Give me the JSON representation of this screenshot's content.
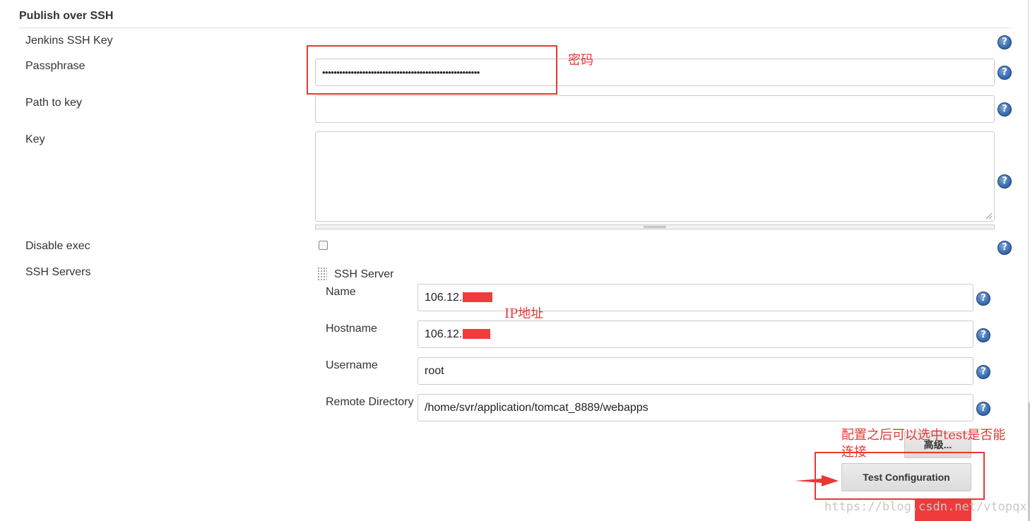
{
  "section": {
    "title": "Publish over SSH"
  },
  "fields": {
    "jenkins_ssh_key": {
      "label": "Jenkins SSH Key"
    },
    "passphrase": {
      "label": "Passphrase",
      "value": "•••••••••••••••••••••••••••••••••••••••••••••••••••••••"
    },
    "path_to_key": {
      "label": "Path to key",
      "value": ""
    },
    "key": {
      "label": "Key",
      "value": ""
    },
    "disable_exec": {
      "label": "Disable exec",
      "checked": false
    },
    "ssh_servers": {
      "label": "SSH Servers"
    }
  },
  "ssh_server": {
    "header": "SSH Server",
    "name": {
      "label": "Name",
      "value": "106.12."
    },
    "hostname": {
      "label": "Hostname",
      "value": "106.12."
    },
    "username": {
      "label": "Username",
      "value": "root"
    },
    "remote_directory": {
      "label": "Remote Directory",
      "value": "/home/svr/application/tomcat_8889/webapps"
    },
    "advanced_button": "高级...",
    "test_button": "Test Configuration"
  },
  "help_icon": "?",
  "annotations": {
    "password": "密码",
    "ip_address": "IP地址",
    "test_note_line1": "配置之后可以选中test是否能",
    "test_note_line2": "连接",
    "watermark": "https://blog.csdn.net/vtopqx"
  },
  "colors": {
    "annotation": "#e53935",
    "help_icon": "#3a6db1"
  }
}
